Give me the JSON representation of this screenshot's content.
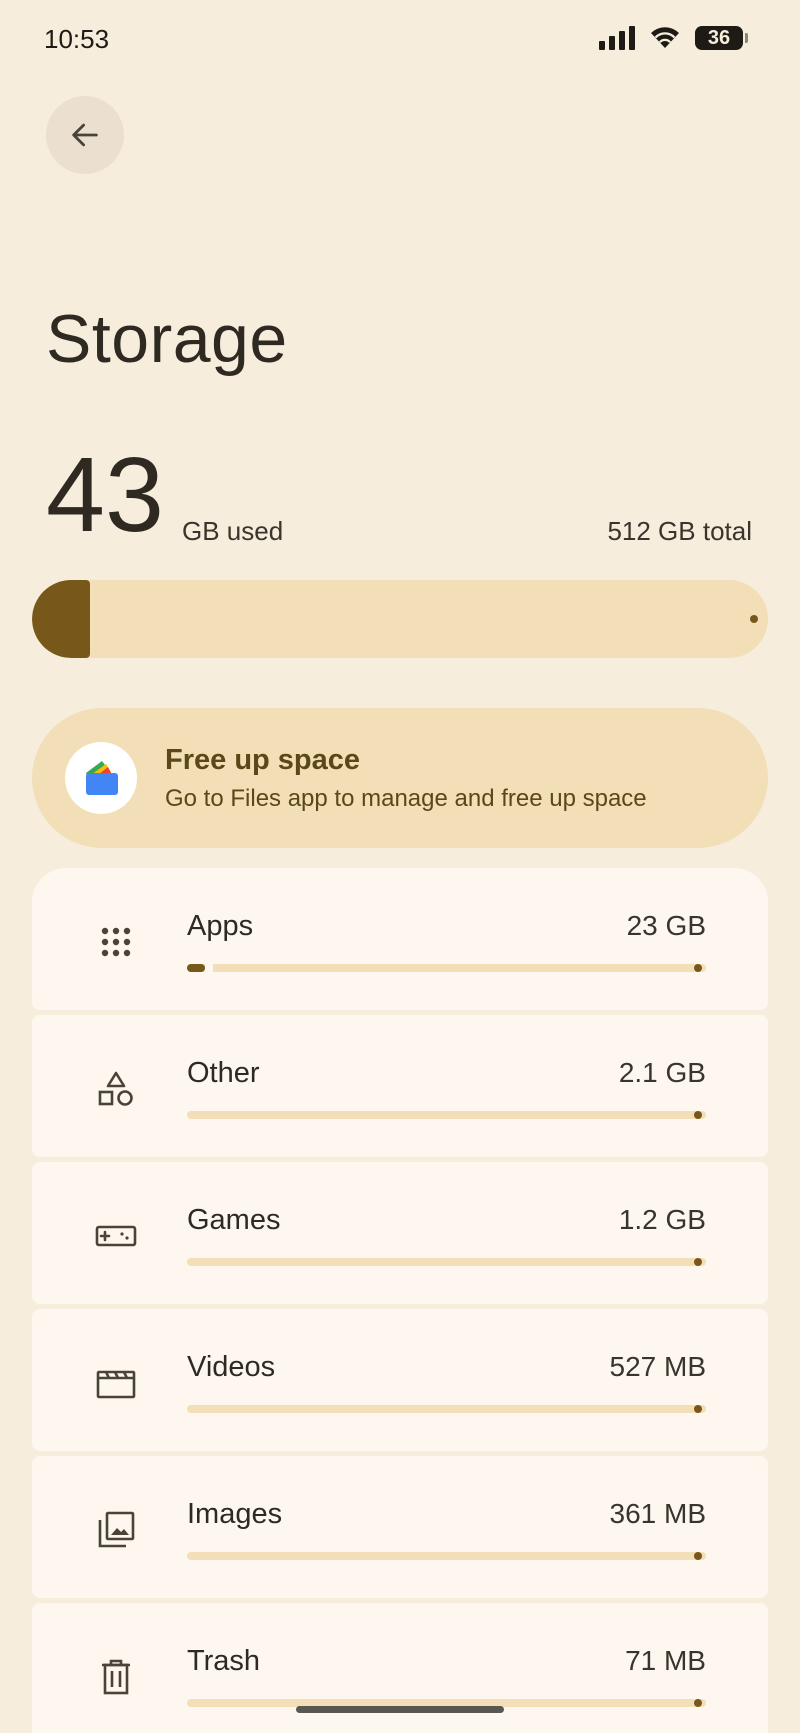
{
  "status_bar": {
    "time": "10:53",
    "battery": "36",
    "icons": [
      "signal-icon",
      "wifi-icon",
      "battery-icon"
    ]
  },
  "header": {
    "back_icon": "arrow-left-icon",
    "title": "Storage"
  },
  "summary": {
    "used_value": "43",
    "used_unit": "GB used",
    "total_text": "512 GB total",
    "used_fraction": 0.084
  },
  "free_up": {
    "icon": "files-app-icon",
    "title": "Free up space",
    "subtitle": "Go to Files app to manage and free up space"
  },
  "categories": [
    {
      "label": "Apps",
      "size": "23 GB",
      "icon": "apps-grid-icon",
      "fraction": 0.045
    },
    {
      "label": "Other",
      "size": "2.1 GB",
      "icon": "shapes-icon",
      "fraction": 0.004
    },
    {
      "label": "Games",
      "size": "1.2 GB",
      "icon": "gamepad-icon",
      "fraction": 0.002
    },
    {
      "label": "Videos",
      "size": "527 MB",
      "icon": "movie-icon",
      "fraction": 0.001
    },
    {
      "label": "Images",
      "size": "361 MB",
      "icon": "images-icon",
      "fraction": 0.0007
    },
    {
      "label": "Trash",
      "size": "71 MB",
      "icon": "trash-icon",
      "fraction": 0.0001
    }
  ],
  "colors": {
    "background": "#f6eddc",
    "accent": "#77581a",
    "track": "#f2dfb8",
    "card": "#fdf7ef"
  }
}
